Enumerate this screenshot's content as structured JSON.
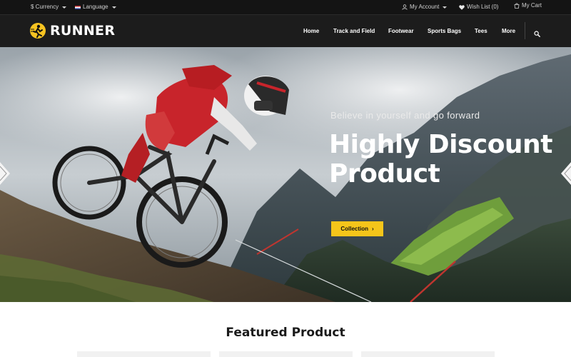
{
  "topbar": {
    "currency_label": "$ Currency",
    "language_label": "Language",
    "account_label": "My Account",
    "wishlist_label": "Wish List (0)",
    "cart_label": "My Cart"
  },
  "header": {
    "logo_text": "RUNNER",
    "nav": [
      "Home",
      "Track and Field",
      "Footwear",
      "Sports Bags",
      "Tees",
      "More"
    ]
  },
  "hero": {
    "tagline": "Believe in yourself and go forward",
    "headline_line1": "Highly Discount",
    "headline_line2": "Product",
    "cta_label": "Collection",
    "cta_arrow": "›"
  },
  "featured": {
    "title": "Featured Product"
  },
  "colors": {
    "accent": "#f5c51a",
    "topbar_bg": "#141414",
    "header_bg": "#1c1c1c",
    "rider_red": "#c8242b"
  },
  "icons": [
    "user-icon",
    "heart-icon",
    "cart-icon",
    "search-icon",
    "slider-prev-icon",
    "slider-next-icon"
  ]
}
